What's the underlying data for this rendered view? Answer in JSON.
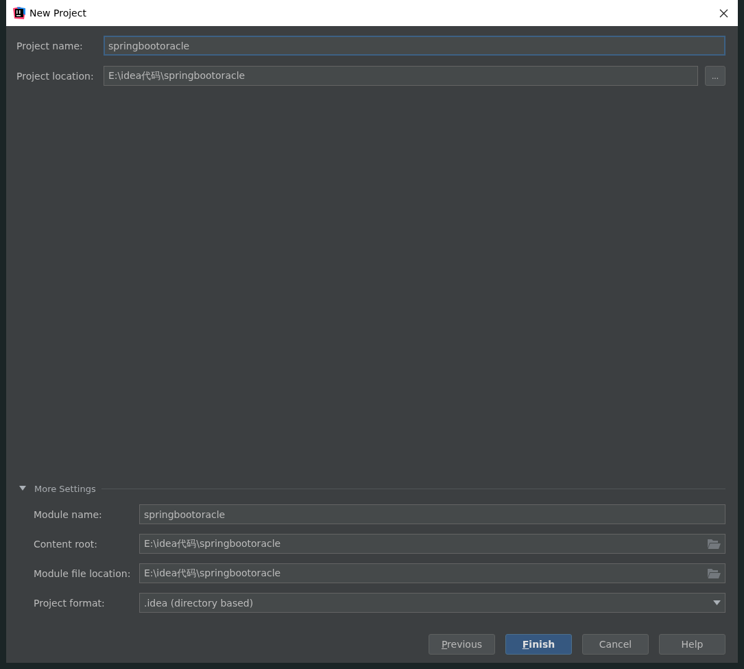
{
  "window": {
    "title": "New Project"
  },
  "project_name": {
    "label": "Project name:",
    "value": "springbootoracle",
    "focused": true
  },
  "project_location": {
    "label": "Project location:",
    "value": "E:\\idea代码\\springbootoracle",
    "browse": "..."
  },
  "more_settings": {
    "title": "More Settings",
    "expanded": true,
    "fields": [
      {
        "kind": "text",
        "label": "Module name:",
        "value": "springbootoracle"
      },
      {
        "kind": "folder",
        "label": "Content root:",
        "value": "E:\\idea代码\\springbootoracle"
      },
      {
        "kind": "folder",
        "label": "Module file location:",
        "value": "E:\\idea代码\\springbootoracle"
      },
      {
        "kind": "select",
        "label": "Project format:",
        "value": ".idea (directory based)"
      }
    ]
  },
  "buttons": [
    {
      "label": "Previous",
      "default": false,
      "mnemonic": true
    },
    {
      "label": "Finish",
      "default": true,
      "mnemonic": true
    },
    {
      "label": "Cancel",
      "default": false,
      "mnemonic": false
    },
    {
      "label": "Help",
      "default": false,
      "mnemonic": false
    }
  ]
}
